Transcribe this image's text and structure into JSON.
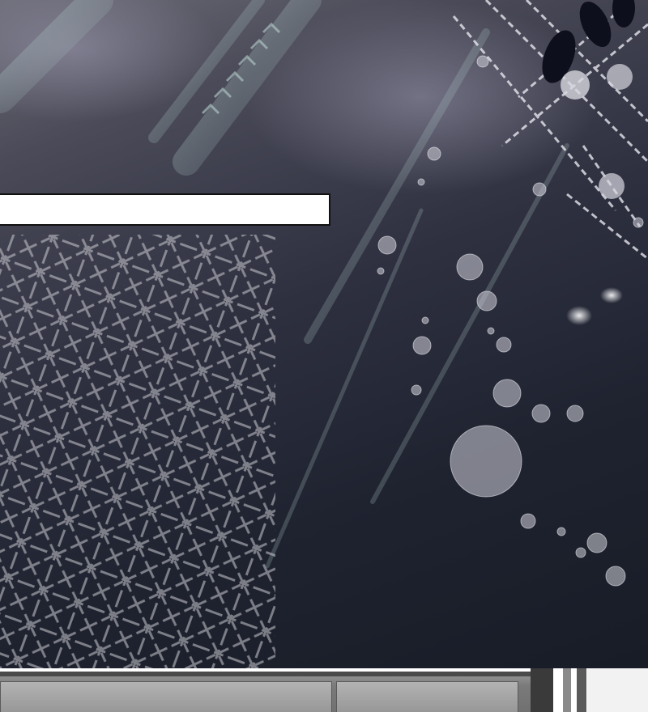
{
  "comic": {
    "caption_text": "",
    "colors": {
      "night_dark": "#1f2330",
      "night_mid": "#2e3040",
      "night_light": "#6d6c78",
      "sparkle": "#d9d9e3",
      "caption_bg": "#ffffff",
      "caption_border": "#111111",
      "cabinet": "#8f8f8f"
    }
  }
}
